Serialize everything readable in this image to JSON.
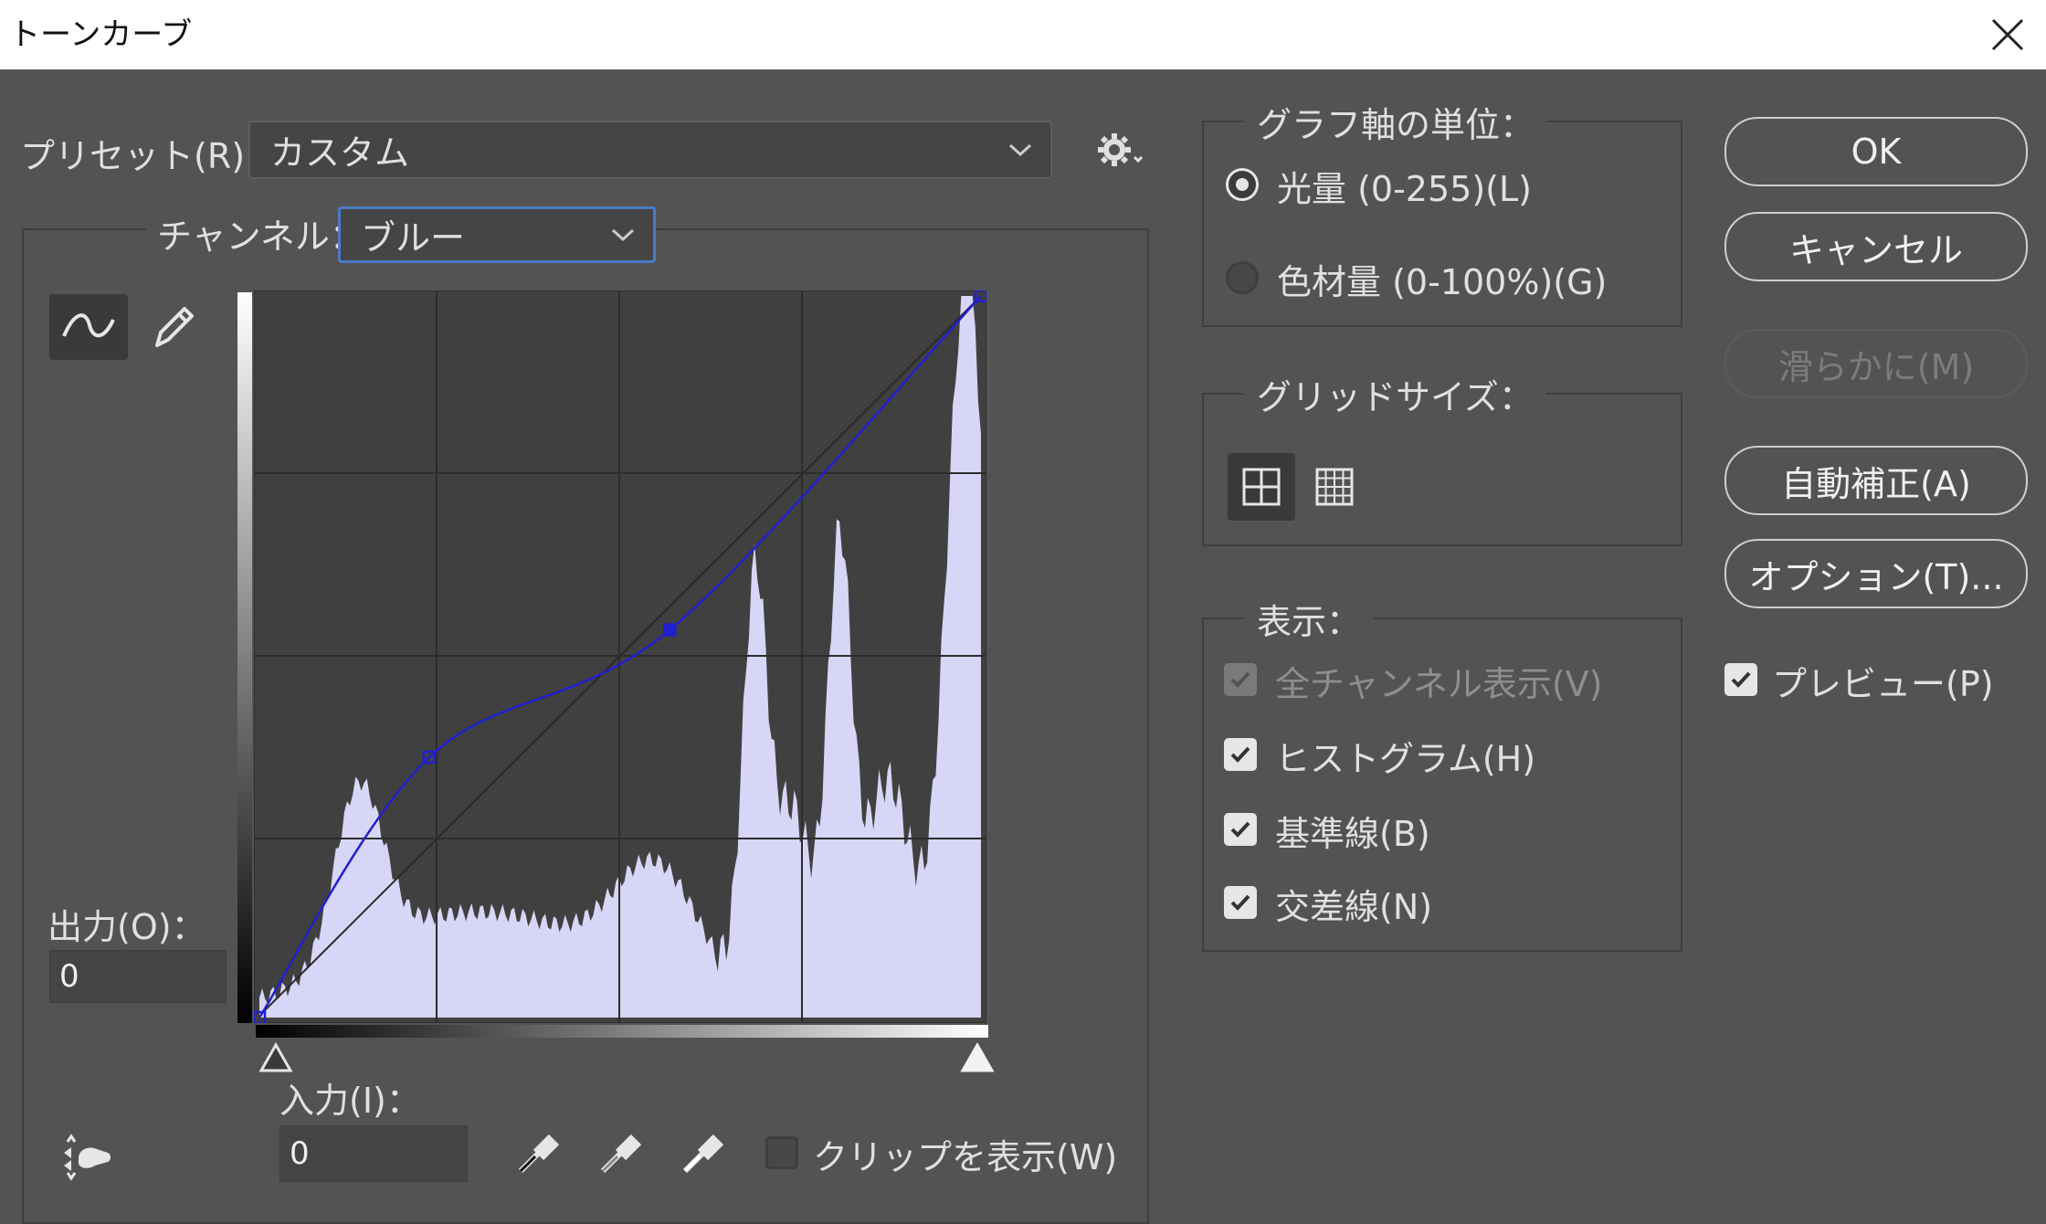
{
  "window": {
    "title": "トーンカーブ"
  },
  "preset": {
    "label": "プリセット(R)：",
    "value": "カスタム"
  },
  "channel": {
    "label": "チャンネル：",
    "value": "ブルー"
  },
  "output": {
    "label": "出力(O)：",
    "value": "0"
  },
  "input": {
    "label": "入力(I)：",
    "value": "0"
  },
  "clip": {
    "label": "クリップを表示(W)",
    "checked": false
  },
  "graph_units": {
    "title": "グラフ軸の単位：",
    "options": [
      {
        "label": "光量 (0-255)(L)",
        "selected": true
      },
      {
        "label": "色材量 (0-100%)(G)",
        "selected": false
      }
    ]
  },
  "grid_size": {
    "title": "グリッドサイズ：",
    "selected": "simple"
  },
  "display": {
    "title": "表示：",
    "options": [
      {
        "label": "全チャンネル表示(V)",
        "checked": true,
        "enabled": false
      },
      {
        "label": "ヒストグラム(H)",
        "checked": true,
        "enabled": true
      },
      {
        "label": "基準線(B)",
        "checked": true,
        "enabled": true
      },
      {
        "label": "交差線(N)",
        "checked": true,
        "enabled": true
      }
    ]
  },
  "buttons": {
    "ok": "OK",
    "cancel": "キャンセル",
    "smooth": "滑らかに(M)",
    "auto": "自動補正(A)",
    "options": "オプション(T)..."
  },
  "preview": {
    "label": "プレビュー(P)",
    "checked": true
  },
  "curve": {
    "channel_color": "#2020d0",
    "histogram_color": "#d8d6f6",
    "points": [
      [
        0,
        0
      ],
      [
        60,
        92
      ],
      [
        145,
        137
      ],
      [
        255,
        255
      ]
    ]
  },
  "icons": {
    "curve_tool": "curve-point-icon",
    "pencil_tool": "pencil-icon",
    "gear": "gear-icon",
    "target_adjust": "hand-target-icon",
    "black_eyedropper": "eyedropper-black-icon",
    "gray_eyedropper": "eyedropper-gray-icon",
    "white_eyedropper": "eyedropper-white-icon"
  }
}
